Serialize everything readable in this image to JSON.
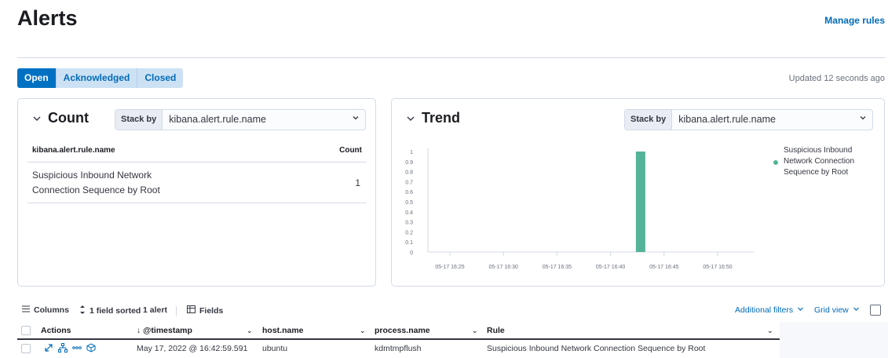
{
  "page": {
    "title": "Alerts",
    "manage_rules": "Manage rules",
    "updated": "Updated 12 seconds ago",
    "tabs": [
      "Open",
      "Acknowledged",
      "Closed"
    ]
  },
  "count_panel": {
    "title": "Count",
    "stack_by_label": "Stack by",
    "stack_by_value": "kibana.alert.rule.name",
    "column_field": "kibana.alert.rule.name",
    "column_count": "Count",
    "rows": [
      {
        "name": "Suspicious Inbound Network Connection Sequence by Root",
        "count": "1"
      }
    ]
  },
  "trend_panel": {
    "title": "Trend",
    "stack_by_label": "Stack by",
    "stack_by_value": "kibana.alert.rule.name",
    "legend": "Suspicious Inbound Network Connection Sequence by Root"
  },
  "chart_data": {
    "type": "bar",
    "x_ticks": [
      "05-17 16:25",
      "05-17 16:30",
      "05-17 16:35",
      "05-17 16:40",
      "05-17 16:45",
      "05-17 16:50"
    ],
    "y_ticks": [
      "0",
      "0.1",
      "0.2",
      "0.3",
      "0.4",
      "0.5",
      "0.6",
      "0.7",
      "0.8",
      "0.9",
      "1"
    ],
    "ylim": [
      0,
      1
    ],
    "series": [
      {
        "name": "Suspicious Inbound Network Connection Sequence by Root",
        "color": "#54b399",
        "points": [
          {
            "x": "05-17 16:42",
            "y": 1
          }
        ]
      }
    ],
    "legend_position": "top-right"
  },
  "toolbar": {
    "columns": "Columns",
    "sorted": "1 field sorted",
    "alerts": "1 alert",
    "fields": "Fields",
    "additional_filters": "Additional filters",
    "grid_view": "Grid view"
  },
  "grid": {
    "headers": [
      "Actions",
      "@timestamp",
      "host.name",
      "process.name",
      "Rule"
    ],
    "rows": [
      {
        "timestamp": "May 17, 2022 @ 16:42:59.591",
        "host": "ubuntu",
        "process": "kdmtmpflush",
        "rule": "Suspicious Inbound Network Connection Sequence by Root"
      }
    ]
  },
  "colors": {
    "accent": "#0071c2",
    "link": "#006bb8",
    "series": "#54b399"
  }
}
